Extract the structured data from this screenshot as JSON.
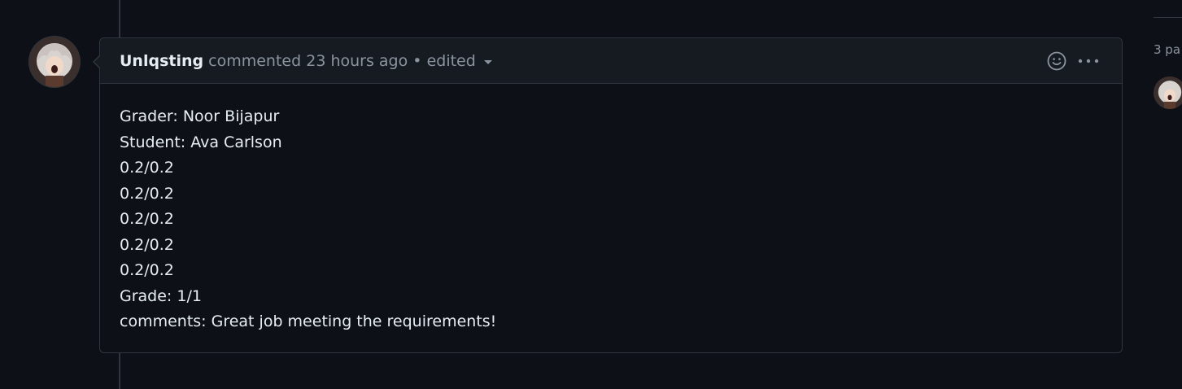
{
  "comment": {
    "author": "Unlqsting",
    "action": "commented",
    "timestamp": "23 hours ago",
    "separator": "•",
    "edited_label": "edited",
    "icons": {
      "reaction": "smiley-icon",
      "menu": "kebab-horizontal-icon",
      "edited_dropdown": "triangle-down-icon"
    },
    "body_lines": [
      "Grader: Noor Bijapur",
      "Student: Ava Carlson",
      "0.2/0.2",
      "0.2/0.2",
      "0.2/0.2",
      "0.2/0.2",
      "0.2/0.2",
      "Grade: 1/1",
      "comments: Great job meeting the requirements!"
    ]
  },
  "sidebar": {
    "participants_text": "3 pa"
  },
  "colors": {
    "background": "#0d1117",
    "header_background": "#161b22",
    "border": "#30363d",
    "text_primary": "#e6edf3",
    "text_muted": "#8b949e"
  }
}
